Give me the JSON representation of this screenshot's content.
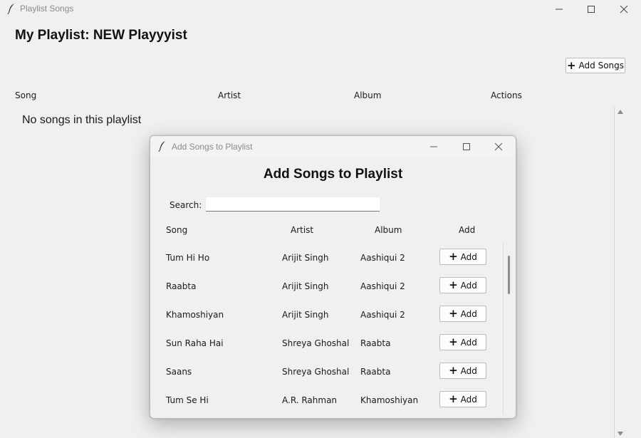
{
  "window": {
    "title": "Playlist Songs",
    "page_title": "My Playlist: NEW Playyyist",
    "add_songs_label": "Add Songs",
    "columns": [
      "Song",
      "Artist",
      "Album",
      "Actions"
    ],
    "empty_message": "No songs in this playlist"
  },
  "dialog": {
    "title": "Add Songs to Playlist",
    "heading": "Add Songs to Playlist",
    "search_label": "Search:",
    "search_value": "",
    "columns": [
      "Song",
      "Artist",
      "Album",
      "Add"
    ],
    "add_label": "Add",
    "rows": [
      {
        "song": "Tum Hi Ho",
        "artist": "Arijit Singh",
        "album": "Aashiqui 2"
      },
      {
        "song": "Raabta",
        "artist": "Arijit Singh",
        "album": "Aashiqui 2"
      },
      {
        "song": "Khamoshiyan",
        "artist": "Arijit Singh",
        "album": "Aashiqui 2"
      },
      {
        "song": "Sun Raha Hai",
        "artist": "Shreya Ghoshal",
        "album": "Raabta"
      },
      {
        "song": "Saans",
        "artist": "Shreya Ghoshal",
        "album": "Raabta"
      },
      {
        "song": "Tum Se Hi",
        "artist": "A.R. Rahman",
        "album": "Khamoshiyan"
      }
    ]
  },
  "icons": {
    "app": "feather-icon",
    "minimize": "minimize-icon",
    "maximize": "maximize-icon",
    "close": "close-icon",
    "plus": "plus-icon"
  }
}
